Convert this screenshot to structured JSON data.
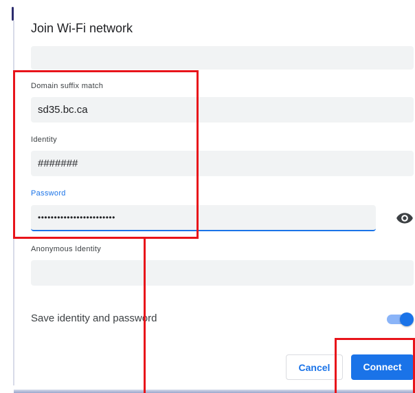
{
  "dialog": {
    "title": "Join Wi-Fi network",
    "domain_suffix": {
      "label": "Domain suffix match",
      "value": "sd35.bc.ca"
    },
    "identity": {
      "label": "Identity",
      "value": "#######"
    },
    "password": {
      "label": "Password",
      "value": "••••••••••••••••••••••••",
      "reveal_icon": "eye-icon"
    },
    "anonymous_identity": {
      "label": "Anonymous Identity",
      "value": ""
    },
    "save_toggle": {
      "label": "Save identity and password",
      "state": "on"
    },
    "buttons": {
      "cancel": "Cancel",
      "connect": "Connect"
    }
  },
  "colors": {
    "accent": "#1a73e8",
    "field_bg": "#f1f3f4",
    "annotation": "#e8141a"
  }
}
